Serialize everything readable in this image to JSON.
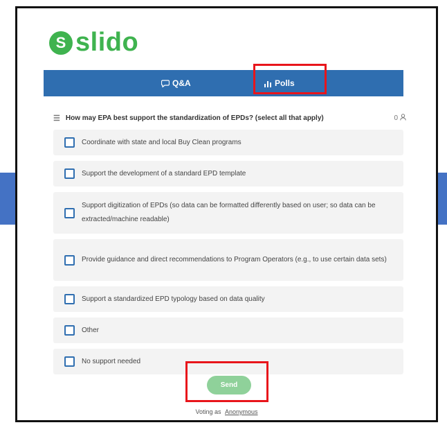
{
  "app": {
    "logo_text": "slido",
    "logo_mark": "S",
    "brand_color": "#3fb34f"
  },
  "tabs": [
    {
      "label": "Q&A",
      "icon": "chat-bubble-icon"
    },
    {
      "label": "Polls",
      "icon": "bar-chart-icon",
      "active": true
    }
  ],
  "poll": {
    "question": "How may EPA best support the standardization of EPDs? (select all that apply)",
    "participants": "0",
    "options": [
      "Coordinate with state and local Buy Clean programs",
      "Support the development of a standard EPD template",
      "Support digitization of EPDs (so data can be formatted differently based on user; so data can be extracted/machine readable)",
      "Provide guidance and direct recommendations to Program Operators (e.g., to use certain data sets)",
      "Support a standardized EPD typology based on data quality",
      "Other",
      "No support needed"
    ],
    "send_label": "Send",
    "voting_prefix": "Voting as",
    "voting_user": "Anonymous"
  },
  "colors": {
    "tabbar": "#2f6eb0",
    "highlight": "#e8151b",
    "send_button": "#8fd19a",
    "side_accent": "#4472c4"
  }
}
